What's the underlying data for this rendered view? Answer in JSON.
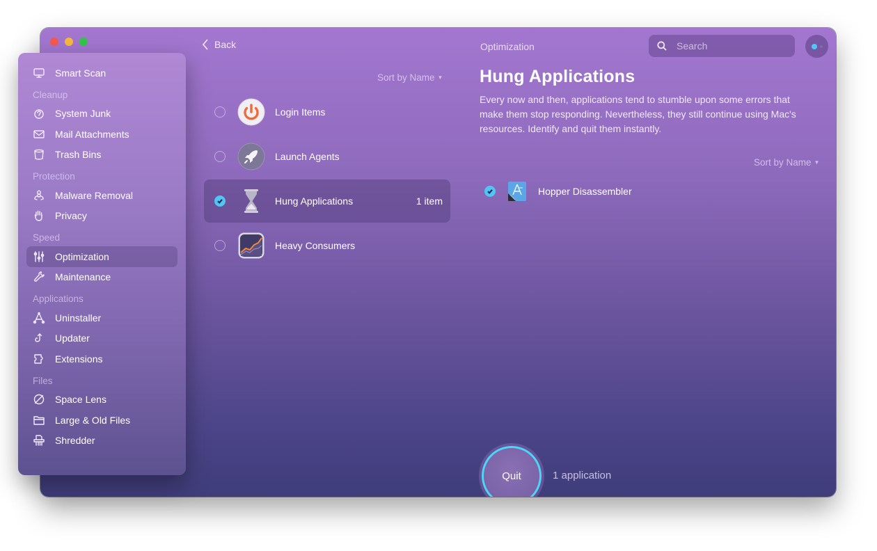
{
  "window": {
    "title": "Optimization",
    "back_label": "Back",
    "search": {
      "placeholder": "Search",
      "value": ""
    }
  },
  "sidebar": {
    "top_item": {
      "label": "Smart Scan",
      "icon": "monitor-icon"
    },
    "sections": [
      {
        "title": "Cleanup",
        "items": [
          {
            "label": "System Junk",
            "icon": "junk-icon"
          },
          {
            "label": "Mail Attachments",
            "icon": "mail-icon"
          },
          {
            "label": "Trash Bins",
            "icon": "trash-icon"
          }
        ]
      },
      {
        "title": "Protection",
        "items": [
          {
            "label": "Malware Removal",
            "icon": "biohazard-icon"
          },
          {
            "label": "Privacy",
            "icon": "hand-icon"
          }
        ]
      },
      {
        "title": "Speed",
        "items": [
          {
            "label": "Optimization",
            "icon": "sliders-icon",
            "active": true
          },
          {
            "label": "Maintenance",
            "icon": "wrench-icon"
          }
        ]
      },
      {
        "title": "Applications",
        "items": [
          {
            "label": "Uninstaller",
            "icon": "uninstaller-icon"
          },
          {
            "label": "Updater",
            "icon": "updater-icon"
          },
          {
            "label": "Extensions",
            "icon": "puzzle-icon"
          }
        ]
      },
      {
        "title": "Files",
        "items": [
          {
            "label": "Space Lens",
            "icon": "planet-icon"
          },
          {
            "label": "Large & Old Files",
            "icon": "folder-icon"
          },
          {
            "label": "Shredder",
            "icon": "shredder-icon"
          }
        ]
      }
    ]
  },
  "middle": {
    "sort_label": "Sort by Name",
    "items": [
      {
        "label": "Login Items",
        "icon": "power-icon",
        "checked": false,
        "count": ""
      },
      {
        "label": "Launch Agents",
        "icon": "rocket-icon",
        "checked": false,
        "count": ""
      },
      {
        "label": "Hung Applications",
        "icon": "hourglass-icon",
        "checked": true,
        "count": "1 item"
      },
      {
        "label": "Heavy Consumers",
        "icon": "chart-icon",
        "checked": false,
        "count": ""
      }
    ]
  },
  "detail": {
    "title": "Hung Applications",
    "description": "Every now and then, applications tend to stumble upon some errors that make them stop responding. Nevertheless, they still continue using Mac's resources. Identify and quit them instantly.",
    "sort_label": "Sort by Name",
    "apps": [
      {
        "name": "Hopper Disassembler",
        "checked": true
      }
    ]
  },
  "footer": {
    "quit_label": "Quit",
    "count_label": "1 application"
  },
  "colors": {
    "accent": "#4fc6f4",
    "quit_ring": "#4fd3f7",
    "traffic_red": "#f5594e",
    "traffic_yellow": "#f7b640",
    "traffic_green": "#33c548"
  }
}
